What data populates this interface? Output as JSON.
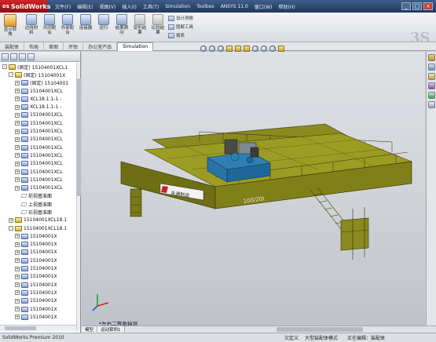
{
  "titlebar": {
    "app_name": "SolidWorks",
    "menus": [
      "文件(F)",
      "编辑(E)",
      "视图(V)",
      "插入(I)",
      "工具(T)",
      "Simulation",
      "Toolbox",
      "ANSYS 11.0",
      "窗口(W)",
      "帮助(H)"
    ],
    "window_buttons": [
      "_",
      "□",
      "×"
    ]
  },
  "command_manager": {
    "buttons": [
      {
        "label": "显示转角",
        "icon": "assembly-icon"
      },
      {
        "label": "边线材料",
        "icon": "edge-icon"
      },
      {
        "label": "共同配合",
        "icon": "mate-icon"
      },
      {
        "label": "外部配合",
        "icon": "external-mate-icon"
      },
      {
        "label": "连接器",
        "icon": "connector-icon"
      },
      {
        "label": "运行",
        "icon": "run-icon"
      },
      {
        "label": "结果顾问",
        "icon": "results-icon"
      },
      {
        "label": "变形结果",
        "icon": "deform-icon"
      },
      {
        "label": "比较结果",
        "icon": "compare-icon"
      }
    ],
    "side_items": [
      {
        "label": "设计洞察",
        "icon": "design-insight-icon"
      },
      {
        "label": "图解工具",
        "icon": "plot-tools-icon"
      },
      {
        "label": "报表",
        "icon": "report-icon"
      }
    ]
  },
  "tabs": [
    "装配体",
    "布局",
    "草图",
    "评估",
    "办公室产品",
    "Simulation"
  ],
  "active_tab": "Simulation",
  "tree": {
    "rows": [
      {
        "indent": 0,
        "expander": "-",
        "icon": "assembly",
        "label": "(固定) 15104001XCL1"
      },
      {
        "indent": 1,
        "expander": "-",
        "icon": "assembly",
        "label": "(固定) 15104001X"
      },
      {
        "indent": 2,
        "expander": "+",
        "icon": "part",
        "label": "(固定) 15104001"
      },
      {
        "indent": 2,
        "expander": "+",
        "icon": "part",
        "label": "15104001XCL"
      },
      {
        "indent": 2,
        "expander": "+",
        "icon": "part",
        "label": "XCL18.1.1-1 -"
      },
      {
        "indent": 2,
        "expander": "+",
        "icon": "part",
        "label": "XCL18.1.1-1 -"
      },
      {
        "indent": 2,
        "expander": "+",
        "icon": "part",
        "label": "15104001XCL"
      },
      {
        "indent": 2,
        "expander": "+",
        "icon": "part",
        "label": "15104001XCL"
      },
      {
        "indent": 2,
        "expander": "+",
        "icon": "part",
        "label": "15104001XCL"
      },
      {
        "indent": 2,
        "expander": "+",
        "icon": "part",
        "label": "15104001XCL"
      },
      {
        "indent": 2,
        "expander": "+",
        "icon": "part",
        "label": "15104001XCL"
      },
      {
        "indent": 2,
        "expander": "+",
        "icon": "part",
        "label": "15104001XCL"
      },
      {
        "indent": 2,
        "expander": "+",
        "icon": "part",
        "label": "15104001XCL"
      },
      {
        "indent": 2,
        "expander": "+",
        "icon": "part",
        "label": "15104001XCL"
      },
      {
        "indent": 2,
        "expander": "+",
        "icon": "part",
        "label": "15104001XCL"
      },
      {
        "indent": 2,
        "expander": "+",
        "icon": "part",
        "label": "15104001XCL"
      },
      {
        "indent": 2,
        "expander": "",
        "icon": "plane",
        "label": "前视基准面"
      },
      {
        "indent": 2,
        "expander": "",
        "icon": "plane",
        "label": "上视基准面"
      },
      {
        "indent": 2,
        "expander": "",
        "icon": "plane",
        "label": "右视基准面"
      },
      {
        "indent": 1,
        "expander": "+",
        "icon": "assembly",
        "label": "15104001XCL18.1"
      },
      {
        "indent": 1,
        "expander": "-",
        "icon": "assembly",
        "label": "15104001XCL18.1"
      },
      {
        "indent": 2,
        "expander": "+",
        "icon": "part",
        "label": "15104001X"
      },
      {
        "indent": 2,
        "expander": "+",
        "icon": "part",
        "label": "15104001X"
      },
      {
        "indent": 2,
        "expander": "+",
        "icon": "part",
        "label": "15104001X"
      },
      {
        "indent": 2,
        "expander": "+",
        "icon": "part",
        "label": "15104001X"
      },
      {
        "indent": 2,
        "expander": "+",
        "icon": "part",
        "label": "15104001X"
      },
      {
        "indent": 2,
        "expander": "+",
        "icon": "part",
        "label": "15104001X"
      },
      {
        "indent": 2,
        "expander": "+",
        "icon": "part",
        "label": "15104001X"
      },
      {
        "indent": 2,
        "expander": "+",
        "icon": "part",
        "label": "15104001X"
      },
      {
        "indent": 2,
        "expander": "+",
        "icon": "part",
        "label": "15104001X"
      },
      {
        "indent": 2,
        "expander": "+",
        "icon": "part",
        "label": "15104001X"
      },
      {
        "indent": 2,
        "expander": "+",
        "icon": "part",
        "label": "15104001X"
      }
    ]
  },
  "viewport": {
    "view_label": "*左右二等角轴测",
    "model_sign_text": "永通制造",
    "model_capacity_text": "100/20t"
  },
  "bottom": {
    "sheet_tabs": [
      "模型",
      "运动算例1"
    ]
  },
  "status": {
    "app_edition": "SolidWorks Premium 2010",
    "undefined": "欠定义",
    "large_assembly": "大型装配体模式",
    "editing": "正在编辑：装配体"
  },
  "colors": {
    "crane_body": "#7a7a1a",
    "trolley": "#2f7fb4",
    "titlebar": "#2c4670"
  }
}
